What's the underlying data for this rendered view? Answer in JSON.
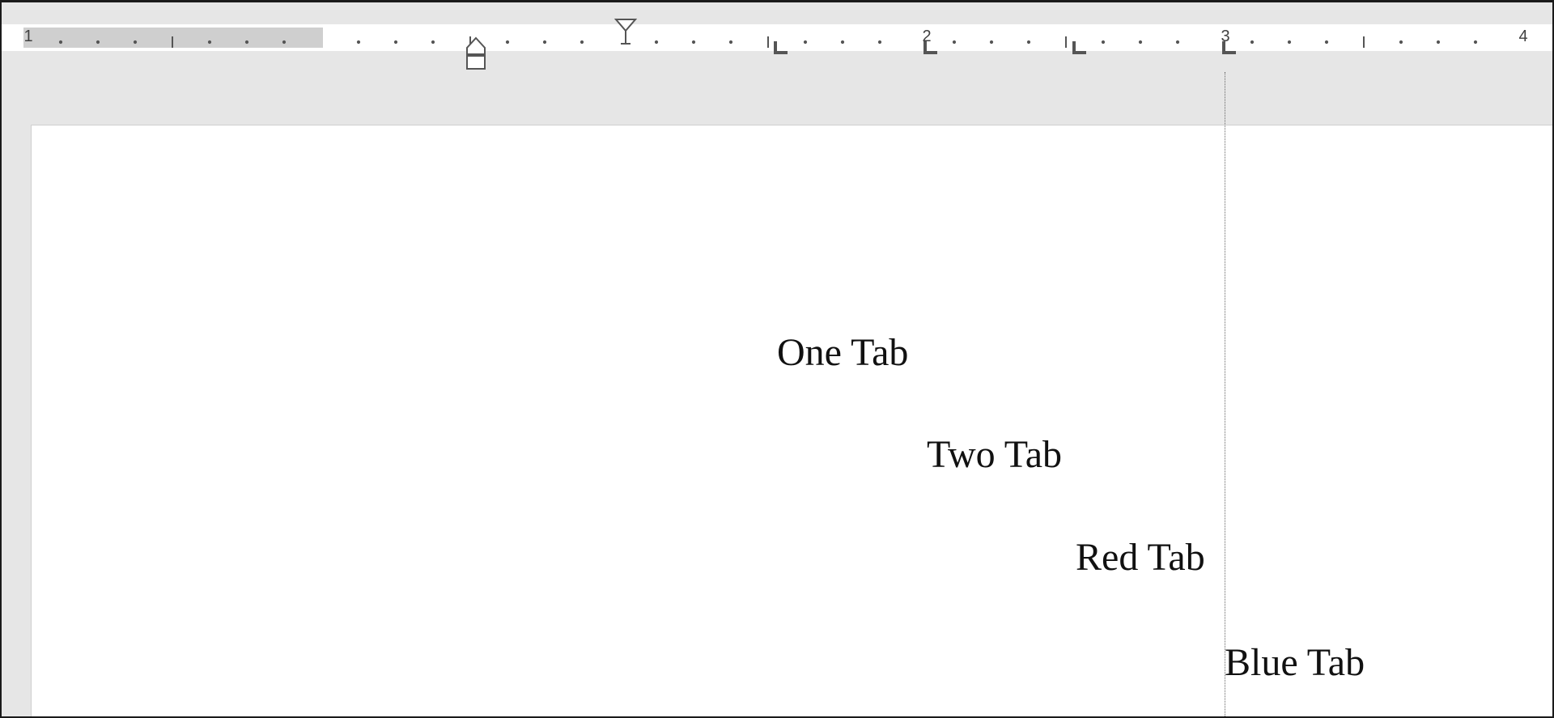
{
  "ruler": {
    "numbers": [
      "1",
      "1",
      "2",
      "3",
      "4"
    ],
    "left_margin_label": "1"
  },
  "document": {
    "lines": [
      {
        "text": "One Tab",
        "tabs": 1
      },
      {
        "text": "Two Tab",
        "tabs": 2
      },
      {
        "text": "Red Tab",
        "tabs": 3
      },
      {
        "text": "Blue Tab",
        "tabs": 4
      }
    ]
  },
  "colors": {
    "workspace": "#e6e6e6",
    "ruler_margin": "#cfcfcf",
    "page": "#ffffff",
    "text": "#111111"
  },
  "icons": {
    "first_line_indent": "first-line-indent-icon",
    "hanging_indent": "hanging-indent-icon",
    "tab_stop": "left-tab-stop-icon"
  }
}
